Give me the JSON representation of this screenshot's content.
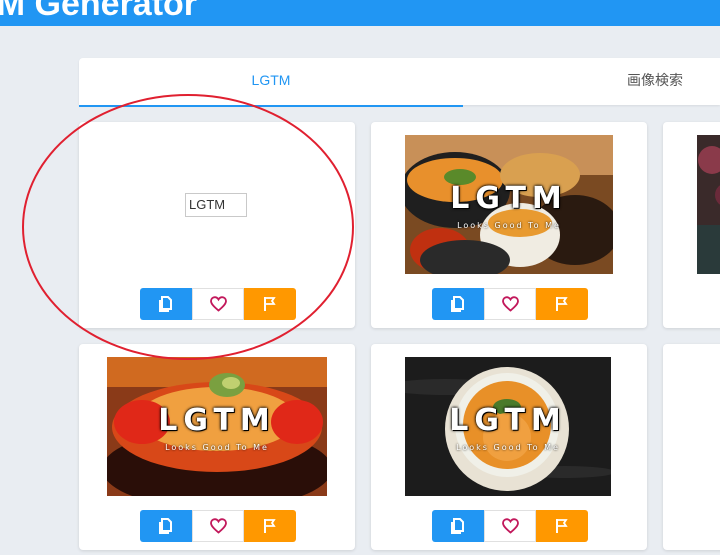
{
  "appbar": {
    "title": "TM Generator"
  },
  "tabs": [
    {
      "label": "LGTM",
      "active": true
    },
    {
      "label": "画像検索",
      "active": false
    }
  ],
  "cards": [
    {
      "broken_alt": "LGTM"
    },
    {
      "big": "LGTM",
      "small": "Looks Good To Me"
    },
    {
      "big": "",
      "small": ""
    },
    {
      "big": "LGTM",
      "small": "Looks Good To Me"
    },
    {
      "big": "LGTM",
      "small": "Looks Good To Me"
    }
  ],
  "icons": {
    "copy": "copy-icon",
    "favorite": "heart-icon",
    "report": "flag-icon"
  },
  "colors": {
    "primary": "#2196f3",
    "accent": "#ff9800",
    "favorite": "#c2185b",
    "annotation": "#e02030",
    "background": "#e9edf2"
  }
}
